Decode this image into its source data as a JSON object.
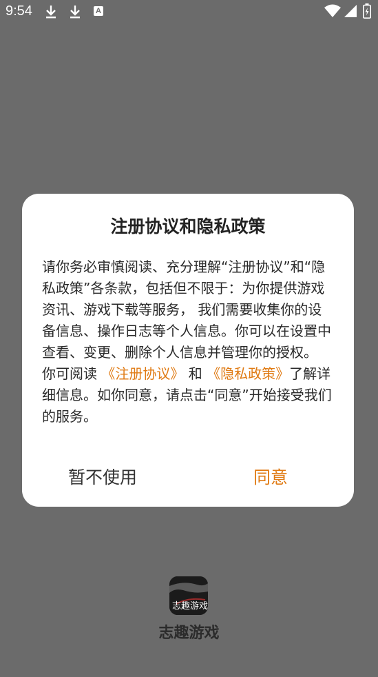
{
  "status_bar": {
    "time": "9:54",
    "icons": [
      "download-icon",
      "download-icon",
      "a-icon",
      "wifi-icon",
      "signal-icon",
      "battery-icon"
    ],
    "a_glyph": "A"
  },
  "dialog": {
    "title": "注册协议和隐私政策",
    "body_part1": "请你务必审慎阅读、充分理解“注册协议”和“隐私政策”各条款，包括但不限于：为你提供游戏资讯、游戏下载等服务， 我们需要收集你的设备信息、操作日志等个人信息。你可以在设置中查看、变更、删除个人信息并管理你的授权。 你可阅读 ",
    "link_agreement": "《注册协议》",
    "body_and": " 和 ",
    "link_privacy": "《隐私政策》",
    "body_part2": "了解详细信息。如你同意，请点击“同意”开始接受我们的服务。",
    "decline_label": "暂不使用",
    "agree_label": "同意"
  },
  "app": {
    "name": "志趣游戏",
    "logo_text": "志趣游戏"
  },
  "colors": {
    "accent": "#e07b14",
    "overlay": "#6b6b6b",
    "dialog_bg": "#ffffff"
  }
}
